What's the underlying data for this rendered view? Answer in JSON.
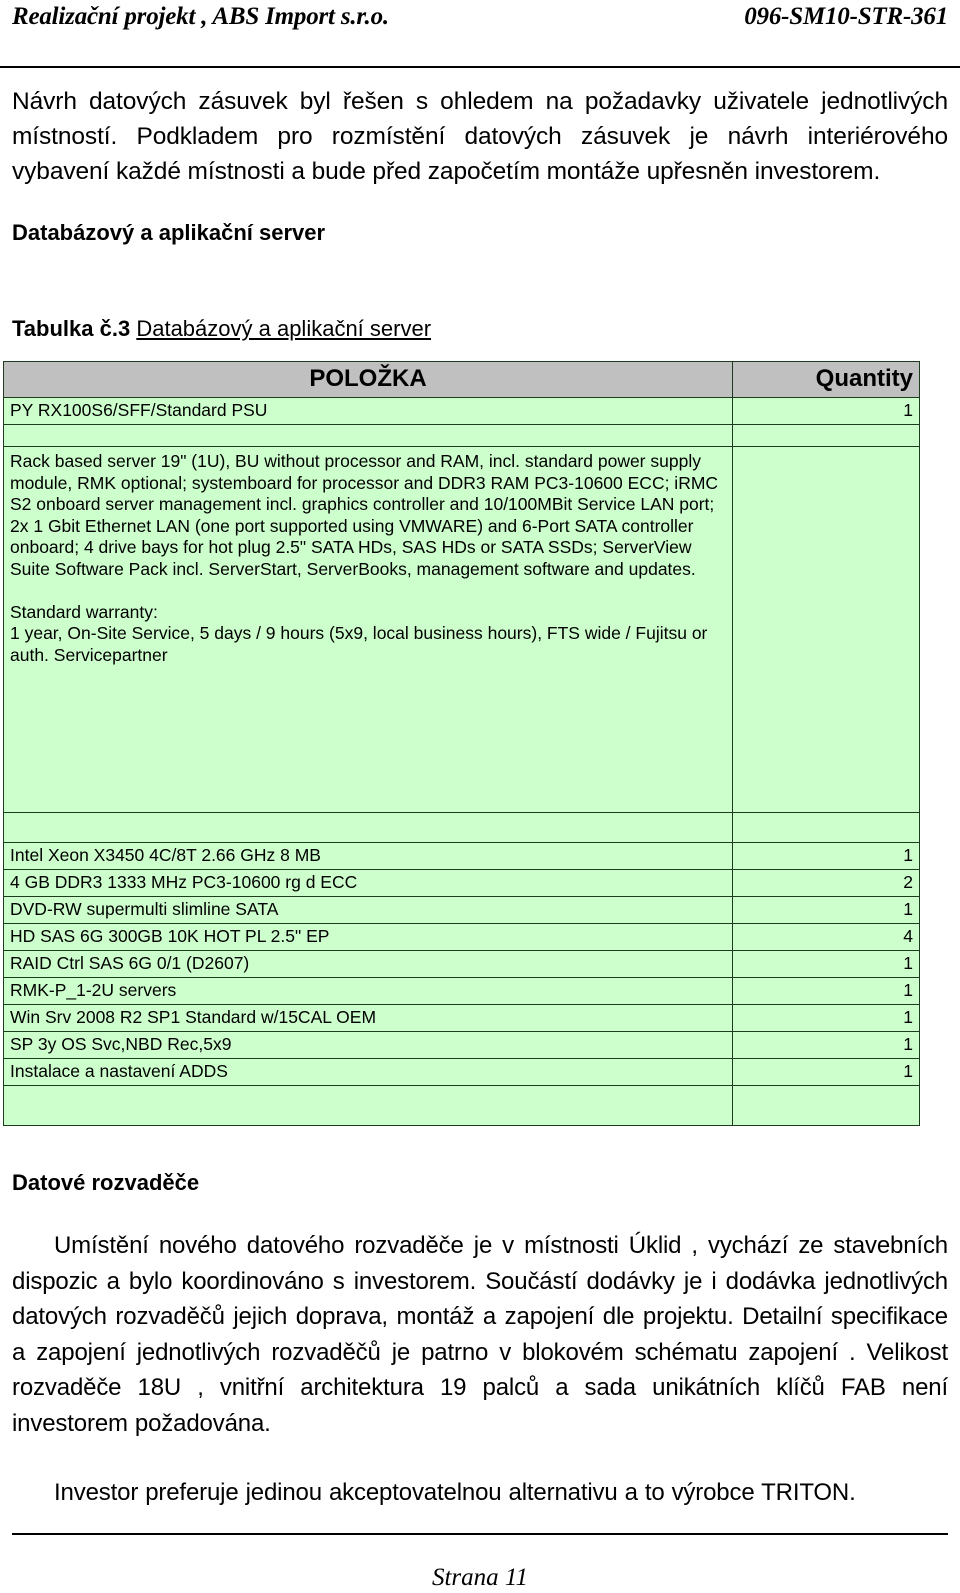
{
  "header": {
    "left": "Realizační projekt , ABS Import s.r.o.",
    "right": "096-SM10-STR-361"
  },
  "intro_paragraph": "Návrh datových  zásuvek byl  řešen s ohledem na požadavky uživatele jednotlivých místností. Podkladem pro rozmístění datových zásuvek je návrh interiérového vybavení každé místnosti a bude před započetím montáže upřesněn investorem.",
  "section_server": {
    "heading": "Databázový a aplikační server",
    "table_label": "Tabulka č.3",
    "table_caption": "Databázový a aplikační server"
  },
  "table": {
    "columns": [
      "POLOŽKA",
      "Quantity"
    ],
    "first_row": {
      "item": "PY RX100S6/SFF/Standard PSU",
      "qty": "1"
    },
    "description": "Rack based server 19\" (1U), BU without processor and RAM, incl. standard power supply module, RMK optional; systemboard for processor and DDR3 RAM PC3-10600 ECC; iRMC S2 onboard server management  incl. graphics controller and 10/100MBit Service LAN port;  2x 1 Gbit Ethernet LAN (one port supported using VMWARE) and 6-Port SATA controller onboard; 4 drive bays for hot plug 2.5\" SATA HDs, SAS HDs or SATA SSDs; ServerView Suite Software Pack incl. ServerStart, ServerBooks, management software and updates.\n\nStandard warranty:\n1 year, On-Site Service, 5 days / 9 hours (5x9, local business hours), FTS wide / Fujitsu or auth. Servicepartner",
    "rows": [
      {
        "item": "Intel Xeon X3450 4C/8T 2.66 GHz 8 MB",
        "qty": "1"
      },
      {
        "item": "4 GB DDR3 1333 MHz PC3-10600 rg d ECC",
        "qty": "2"
      },
      {
        "item": "DVD-RW supermulti slimline SATA",
        "qty": "1"
      },
      {
        "item": "HD SAS 6G 300GB 10K HOT PL 2.5\" EP",
        "qty": "4"
      },
      {
        "item": "RAID Ctrl SAS 6G 0/1 (D2607)",
        "qty": "1"
      },
      {
        "item": "RMK-P_1-2U servers",
        "qty": "1"
      },
      {
        "item": "Win Srv 2008 R2 SP1 Standard w/15CAL OEM",
        "qty": "1"
      },
      {
        "item": "SP 3y OS Svc,NBD Rec,5x9",
        "qty": "1"
      },
      {
        "item": "Instalace a nastavení ADDS",
        "qty": "1"
      }
    ]
  },
  "section_cabinets": {
    "heading": "Datové rozvaděče",
    "paragraph_1": "Umístění nového datového rozvaděče je v místnosti Úklid ,   vychází ze stavebních dispozic a bylo koordinováno s investorem. Součástí dodávky je i dodávka jednotlivých datových rozvaděčů  jejich doprava, montáž a zapojení dle projektu. Detailní specifikace a zapojení jednotlivých rozvaděčů je patrno v blokovém schématu zapojení . Velikost rozvaděče 18U , vnitřní architektura 19 palců a  sada unikátních klíčů FAB není investorem požadována.",
    "paragraph_2": "Investor preferuje jedinou akceptovatelnou alternativu a to   výrobce TRITON."
  },
  "footer": {
    "page_label": "Strana 11"
  },
  "colors": {
    "table_header_bg": "#c0c0c0",
    "table_body_bg": "#ccffcc",
    "table_border": "#1d3b1d",
    "text": "#000000",
    "page_bg": "#ffffff"
  }
}
